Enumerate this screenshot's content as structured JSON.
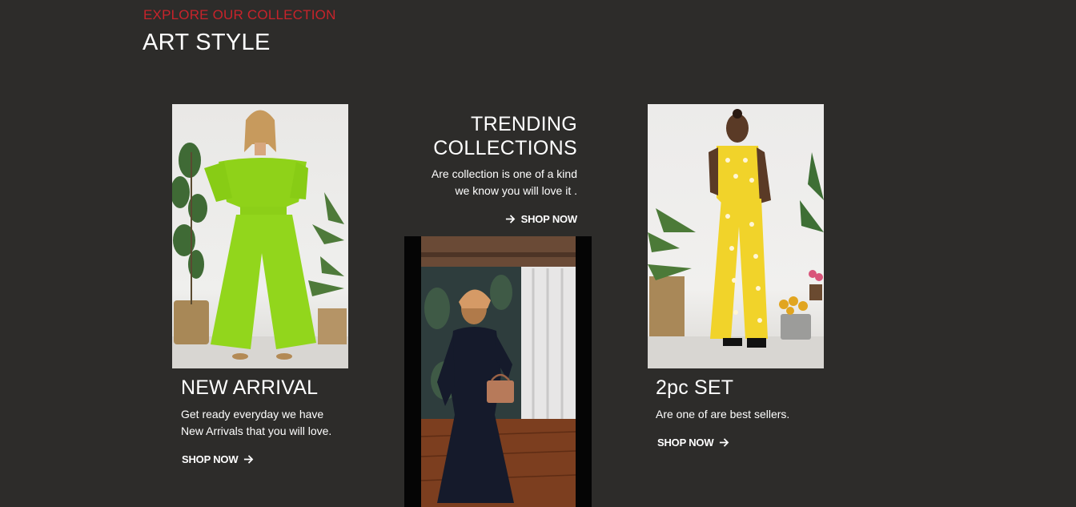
{
  "section": {
    "eyebrow": "EXPLORE OUR COLLECTION",
    "title": "ART STYLE"
  },
  "cards": [
    {
      "title": "NEW ARRIVAL",
      "text_lines": [
        "Get ready everyday we have",
        "New Arrivals that you will love."
      ],
      "cta": "SHOP NOW"
    },
    {
      "title_lines": [
        "TRENDING",
        "COLLECTIONS"
      ],
      "text_lines": [
        "Are collection is one of a kind",
        "we know you will love it ."
      ],
      "cta": "SHOP NOW"
    },
    {
      "title": "2pc SET",
      "text_lines": [
        "Are one of are best sellers."
      ],
      "cta": "SHOP NOW"
    }
  ],
  "colors": {
    "background": "#2d2c2a",
    "accent": "#c8232b",
    "text": "#ffffff"
  },
  "icons": {
    "cta": "arrow-right-icon"
  }
}
